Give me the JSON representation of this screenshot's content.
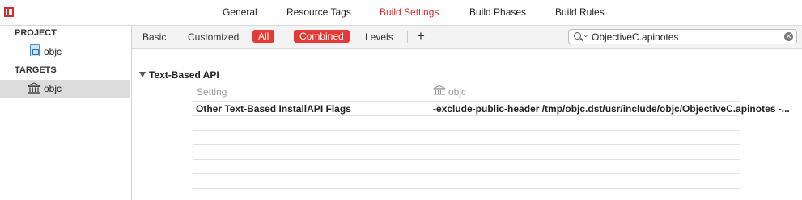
{
  "tabs": [
    {
      "label": "General",
      "active": false
    },
    {
      "label": "Resource Tags",
      "active": false
    },
    {
      "label": "Build Settings",
      "active": true
    },
    {
      "label": "Build Phases",
      "active": false
    },
    {
      "label": "Build Rules",
      "active": false
    }
  ],
  "sidebar": {
    "project_header": "PROJECT",
    "project_item": "objc",
    "targets_header": "TARGETS",
    "target_item": "objc"
  },
  "filters": {
    "basic": "Basic",
    "customized": "Customized",
    "all": "All",
    "combined": "Combined",
    "levels": "Levels",
    "add": "+"
  },
  "search": {
    "value": "ObjectiveC.apinotes"
  },
  "group": {
    "title": "Text-Based API",
    "column_setting": "Setting",
    "column_target": "objc"
  },
  "settings": [
    {
      "name": "Other Text-Based InstallAPI Flags",
      "value": "-exclude-public-header /tmp/objc.dst/usr/include/objc/ObjectiveC.apinotes -..."
    }
  ],
  "colors": {
    "accent": "#d32f2f",
    "pill": "#e53935",
    "selection": "#dcdcdc"
  },
  "icons": {
    "panel_toggle": "panel-toggle-icon",
    "project": "project-file-icon",
    "target": "building-target-icon",
    "search": "search-icon",
    "clear": "clear-icon",
    "disclosure": "disclosure-triangle-icon"
  }
}
